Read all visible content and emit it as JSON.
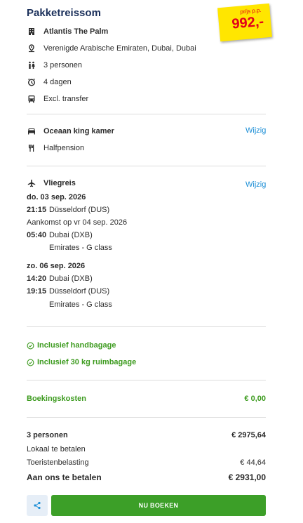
{
  "title": "Pakketreissom",
  "price_sticker": {
    "label": "prijs p.p.",
    "amount": "992,-"
  },
  "hotel": {
    "name": "Atlantis The Palm",
    "location": "Verenigde Arabische Emiraten, Dubai, Dubai",
    "persons": "3 personen",
    "duration": "4 dagen",
    "transfer": "Excl. transfer"
  },
  "room": {
    "type": "Oceaan king kamer",
    "board": "Halfpension",
    "change_label": "Wijzig"
  },
  "flight": {
    "heading": "Vliegreis",
    "change_label": "Wijzig",
    "outbound": {
      "date": "do. 03 sep. 2026",
      "dep_time": "21:15",
      "dep_place": "Düsseldorf (DUS)",
      "arrival_note": "Aankomst op vr 04 sep. 2026",
      "arr_time": "05:40",
      "arr_place": "Dubai (DXB)",
      "carrier": "Emirates - G class"
    },
    "return": {
      "date": "zo. 06 sep. 2026",
      "dep_time": "14:20",
      "dep_place": "Dubai (DXB)",
      "arr_time": "19:15",
      "arr_place": "Düsseldorf (DUS)",
      "carrier": "Emirates - G class"
    }
  },
  "baggage": {
    "hand": "Inclusief handbagage",
    "hold": "Inclusief 30 kg ruimbagage"
  },
  "booking_costs": {
    "label": "Boekingskosten",
    "value": "€ 0,00"
  },
  "summary": {
    "persons_label": "3 personen",
    "persons_value": "€ 2975,64",
    "local_label": "Lokaal te betalen",
    "tax_label": "Toeristenbelasting",
    "tax_value": "€ 44,64",
    "total_label": "Aan ons te betalen",
    "total_value": "€ 2931,00"
  },
  "actions": {
    "book_label": "NU BOEKEN"
  },
  "colors": {
    "brand_blue": "#1a2f5a",
    "link": "#1d8fd6",
    "green": "#3d9b1f",
    "sticker": "#ffe600",
    "price_red": "#e2001a"
  }
}
